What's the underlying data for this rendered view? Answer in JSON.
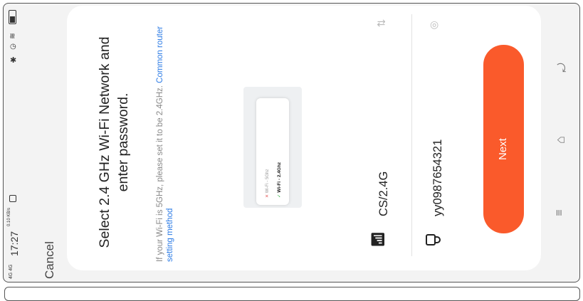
{
  "status_bar": {
    "signal": "4G 4G",
    "time": "17:27",
    "speed": "0.10 KB/s",
    "icons": [
      "signal-icon",
      "bluetooth-icon",
      "alarm-icon",
      "wifi-icon",
      "battery-icon"
    ]
  },
  "header": {
    "cancel_label": "Cancel"
  },
  "main": {
    "title": "Select 2.4 GHz Wi-Fi Network and enter password.",
    "hint_text": "If your Wi-Fi is 5GHz, please set it to be 2.4GHz.",
    "hint_link": "Common router setting method",
    "illustration": {
      "bad_label": "Wi-Fi - 5Ghz",
      "good_label": "Wi-Fi - 2.4Ghz"
    },
    "network": {
      "ssid": "CS/2.4G",
      "password": "yy0987654321"
    },
    "next_label": "Next"
  },
  "colors": {
    "accent": "#fa5a2b",
    "link": "#2c7be5"
  }
}
